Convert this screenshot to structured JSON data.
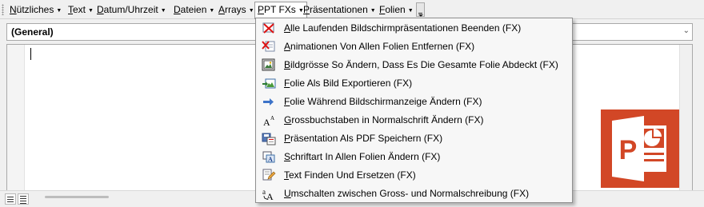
{
  "menubar": {
    "items": [
      {
        "label": "Nützliches",
        "active": false
      },
      {
        "label": "Text",
        "active": false
      },
      {
        "label": "Datum/Uhrzeit",
        "active": false
      },
      {
        "label": "Dateien",
        "active": false
      },
      {
        "label": "Arrays",
        "active": false
      },
      {
        "label": "PPT FXs",
        "active": true
      },
      {
        "label": "Präsentationen",
        "active": false
      },
      {
        "label": "Folien",
        "active": false
      }
    ]
  },
  "combo": {
    "value": "(General)"
  },
  "dropdown": {
    "items": [
      {
        "label": "Alle Laufenden Bildschirmpräsentationen Beenden (FX)",
        "icon": "stop-slideshows-icon"
      },
      {
        "label": "Animationen Von Allen Folien Entfernen (FX)",
        "icon": "remove-animations-icon"
      },
      {
        "label": "Bildgrösse So Ändern, Dass Es Die Gesamte Folie Abdeckt (FX)",
        "icon": "image-resize-icon"
      },
      {
        "label": "Folie Als Bild Exportieren (FX)",
        "icon": "export-image-icon"
      },
      {
        "label": "Folie Während Bildschirmanzeige Ändern (FX)",
        "icon": "arrow-right-icon"
      },
      {
        "label": "Grossbuchstaben in Normalschrift Ändern (FX)",
        "icon": "font-case-icon"
      },
      {
        "label": "Präsentation Als PDF Speichern (FX)",
        "icon": "save-pdf-icon"
      },
      {
        "label": "Schriftart In Allen Folien Ändern (FX)",
        "icon": "change-font-icon"
      },
      {
        "label": "Text Finden Und Ersetzen (FX)",
        "icon": "find-replace-icon"
      },
      {
        "label": "Umschalten zwischen Gross- und Normalschreibung (FX)",
        "icon": "toggle-case-icon"
      }
    ]
  },
  "colors": {
    "ppt_orange": "#d24726",
    "menu_bg": "#f0f0f0",
    "dropdown_bg": "#f7f7f7"
  }
}
